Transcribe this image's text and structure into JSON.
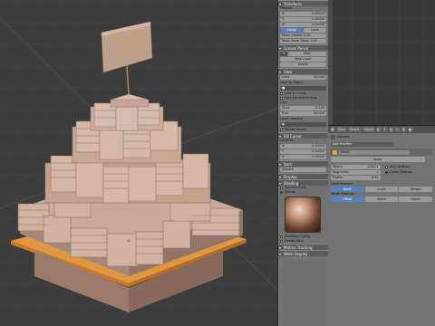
{
  "props": {
    "transform_header": "Transform",
    "median_label": "Median:",
    "median": [
      {
        "axis": "X:",
        "value": "0.00000"
      },
      {
        "axis": "Y:",
        "value": "0.00000"
      },
      {
        "axis": "Z:",
        "value": "0.00000"
      }
    ],
    "global_btn": "Global",
    "local_btn": "Local",
    "mean_crease": "Mean Crease: 0.00",
    "mean_bevel": "Mean Bevel Weig: 0.00",
    "grease_header": "Grease Pencil",
    "new_btn": "New",
    "new_layer_btn": "New Layer",
    "delete_btn": "Delete",
    "view_header": "View",
    "lens": {
      "label": "Lens:",
      "value": "35.000"
    },
    "lock_to_object": "Lock to Object:",
    "lock_to_cursor": "Lock to Cursor",
    "lock_camera": "Lock Camera to View",
    "clip_label": "Clip:",
    "clip_start": {
      "label": "Start:",
      "value": "0.100"
    },
    "clip_end": {
      "label": "End:",
      "value": "50.000"
    },
    "local_camera": "Local Camera:",
    "render_border": "Render Border",
    "cursor_header": "3D Cursor",
    "location_label": "Location:",
    "location": [
      {
        "axis": "X:",
        "value": "0.00000"
      },
      {
        "axis": "Y:",
        "value": "0.00000"
      },
      {
        "axis": "Z:",
        "value": "0.00000"
      }
    ],
    "item_header": "Item",
    "item_name": "Voltaire",
    "display_header": "Display",
    "shading_header": "Shading",
    "textured_solid": "Textured Solid",
    "matcap": "Matcap",
    "backface_culling": "Backface Culling",
    "hidden_wire": "Hidden Wire",
    "motion_tracking": "Motion Tracking",
    "mesh_display": "Mesh Display"
  },
  "header": {
    "view": "View",
    "select": "Select",
    "mode": "Object Mode"
  },
  "mods": {
    "object_name": "Voltaire",
    "add_modifier": "Add Modifier",
    "modifier_name": "Bevel",
    "apply": "Apply",
    "width": {
      "label": "Width:",
      "value": "0.0011"
    },
    "segments": {
      "label": "Segments:",
      "value": "1"
    },
    "profile": {
      "label": "Profile:",
      "value": "0.50"
    },
    "only_vertices": "Only Vertices",
    "clamp_overlap": "Clamp Overlap",
    "limit_method": "Limit Method:",
    "limit_opts": [
      "None",
      "Angle",
      "Weight"
    ],
    "width_method": "Width Method:",
    "width_opts": [
      "Offset",
      "Width",
      "Depth"
    ]
  },
  "colors": {
    "accent": "#5680c2",
    "orange": "#e0a34a",
    "model": "#b89a87"
  }
}
